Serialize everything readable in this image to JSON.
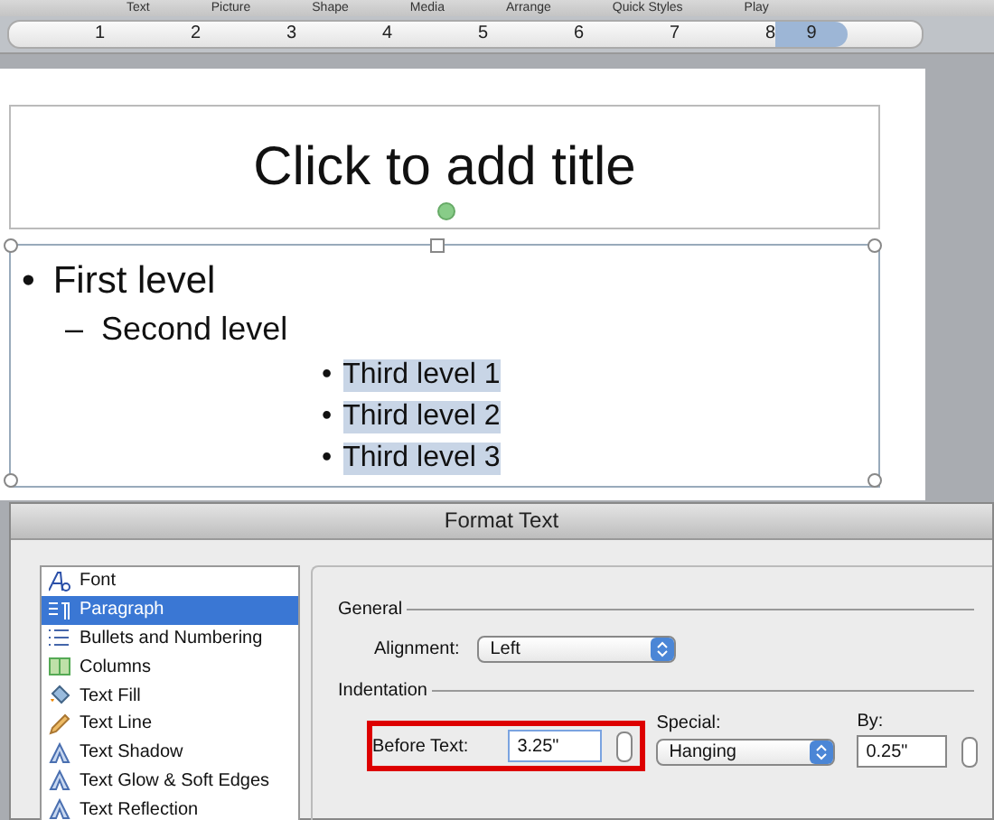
{
  "toolbar": {
    "items": [
      "Text",
      "Picture",
      "Shape",
      "Media",
      "Arrange",
      "Quick Styles",
      "Play"
    ]
  },
  "ruler": {
    "numbers": [
      "1",
      "2",
      "3",
      "4",
      "5",
      "6",
      "7",
      "8",
      "9"
    ]
  },
  "slide": {
    "title_placeholder": "Click to add title",
    "bullets": [
      {
        "bullet": "•",
        "text": "First level",
        "kind": "first",
        "highlighted": false
      },
      {
        "bullet": "–",
        "text": "Second level",
        "kind": "second",
        "highlighted": false
      },
      {
        "bullet": "•",
        "text": "Third level 1",
        "kind": "third",
        "highlighted": true
      },
      {
        "bullet": "•",
        "text": "Third level 2",
        "kind": "third",
        "highlighted": true
      },
      {
        "bullet": "•",
        "text": "Third level 3",
        "kind": "third",
        "highlighted": true
      }
    ]
  },
  "dialog": {
    "title": "Format Text",
    "categories": [
      {
        "label": "Font",
        "kind": "font",
        "selected": false
      },
      {
        "label": "Paragraph",
        "kind": "paragraph",
        "selected": true
      },
      {
        "label": "Bullets and Numbering",
        "kind": "bullets",
        "selected": false
      },
      {
        "label": "Columns",
        "kind": "columns",
        "selected": false
      },
      {
        "label": "Text Fill",
        "kind": "fill",
        "selected": false
      },
      {
        "label": "Text Line",
        "kind": "line",
        "selected": false
      },
      {
        "label": "Text Shadow",
        "kind": "letter",
        "selected": false
      },
      {
        "label": "Text Glow & Soft Edges",
        "kind": "letter",
        "selected": false
      },
      {
        "label": "Text Reflection",
        "kind": "letter",
        "selected": false
      }
    ],
    "general_heading": "General",
    "alignment_label": "Alignment:",
    "alignment_value": "Left",
    "indentation_heading": "Indentation",
    "before_text_label": "Before Text:",
    "before_text_value": "3.25\"",
    "special_label": "Special:",
    "special_value": "Hanging",
    "by_label": "By:",
    "by_value": "0.25\""
  }
}
